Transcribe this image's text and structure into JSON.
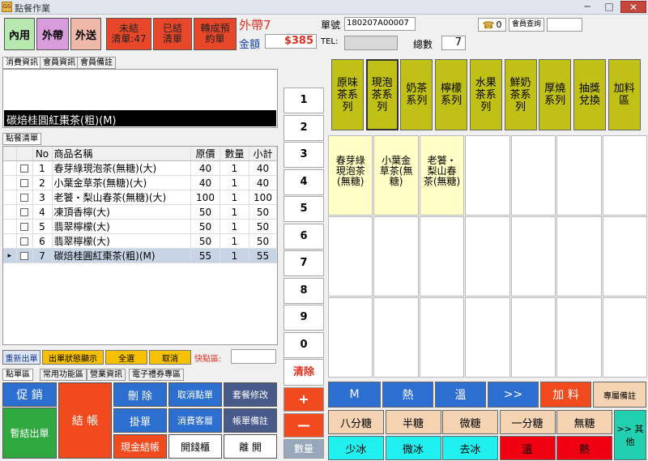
{
  "window": {
    "title": "點餐作業",
    "logo_text": "GS",
    "close_glyph": "✕",
    "minimize_glyph": "─",
    "maximize_glyph": "□"
  },
  "order_type_buttons": [
    {
      "label": "內用",
      "color": "#b7e8b0"
    },
    {
      "label": "外帶",
      "color": "#d99cdc"
    },
    {
      "label": "外送",
      "color": "#f0b8a8"
    }
  ],
  "status_buttons": [
    {
      "line1": "未結",
      "line2": "清單:47"
    },
    {
      "line1": "已結",
      "line2": "清單"
    },
    {
      "line1": "轉成預",
      "line2": "約單"
    }
  ],
  "order_info": {
    "mode_label": "外帶7",
    "amount_label": "金額",
    "amount_value": "$385",
    "order_no_label": "單號",
    "order_no_value": "180207A00007",
    "tel_label": "TEL:",
    "tel_value": "",
    "total_qty_label": "總數",
    "total_qty_value": "7",
    "phone_count": "0",
    "member_query_label": "會員查詢",
    "member_query_value": ""
  },
  "info_tabs": [
    "消費資訊",
    "會員資訊",
    "會員備註"
  ],
  "current_item_display": "碳焙桂圓紅棗茶(粗)(M)",
  "order_list": {
    "tab_label": "點餐清單",
    "columns": [
      "No",
      "商品名稱",
      "原價",
      "數量",
      "小計"
    ],
    "rows": [
      {
        "no": "1",
        "name": "春芽綠現泡茶(無糖)(大)",
        "price": "40",
        "qty": "1",
        "subtotal": "40"
      },
      {
        "no": "2",
        "name": "小葉金草茶(無糖)(大)",
        "price": "40",
        "qty": "1",
        "subtotal": "40"
      },
      {
        "no": "3",
        "name": "老饕・梨山春茶(無糖)(大)",
        "price": "100",
        "qty": "1",
        "subtotal": "100"
      },
      {
        "no": "4",
        "name": "凍頂香檸(大)",
        "price": "50",
        "qty": "1",
        "subtotal": "50"
      },
      {
        "no": "5",
        "name": "翡翠檸檬(大)",
        "price": "50",
        "qty": "1",
        "subtotal": "50"
      },
      {
        "no": "6",
        "name": "翡翠檸檬(大)",
        "price": "50",
        "qty": "1",
        "subtotal": "50"
      },
      {
        "no": "7",
        "name": "碳焙桂圓紅棗茶(粗)(M)",
        "price": "55",
        "qty": "1",
        "subtotal": "55"
      }
    ]
  },
  "list_actions": {
    "reissue": "重新出單",
    "status_show": "出單狀態顯示",
    "select_all": "全選",
    "cancel": "取消",
    "quick_label": "快點區:",
    "quick_value": ""
  },
  "bottom_tabs": [
    "點單區",
    "常用功能區",
    "營業資訊",
    "電子禮券專區"
  ],
  "function_buttons": {
    "promo": "促 銷",
    "temp_out": "暫結出單",
    "checkout": "結 帳",
    "delete": "刪 除",
    "hang": "掛單",
    "cash_checkout": "現金結帳",
    "cancel_item": "取消點單",
    "customer_level": "消費客層",
    "open_drawer": "開錢櫃",
    "package_edit": "套餐修改",
    "bill_note": "帳單備註",
    "leave": "離 開"
  },
  "numpad": {
    "keys": [
      "1",
      "2",
      "3",
      "4",
      "5",
      "6",
      "7",
      "8",
      "9",
      "0"
    ],
    "clear": "清除",
    "plus": "+",
    "minus": "—",
    "qty_label": "數量"
  },
  "categories": [
    "原味茶系列",
    "現泡茶系列",
    "奶茶系列",
    "檸檬系列",
    "水果茶系列",
    "鮮奶茶系列",
    "厚燒系列",
    "抽獎兌換",
    "加料區"
  ],
  "products": [
    "春芽綠現泡茶(無糖)",
    "小葉金草茶(無糖)",
    "老饕・梨山春茶(無糖)"
  ],
  "options": {
    "size_temp": [
      "M",
      "熱",
      "溫",
      ">>"
    ],
    "topping": "加 料",
    "special_note": "專屬備註",
    "sugar": [
      "八分糖",
      "半糖",
      "微糖",
      "一分糖",
      "無糖"
    ],
    "ice": [
      "少冰",
      "微冰",
      "去冰",
      "溫",
      "熱"
    ],
    "other": ">> 其他"
  }
}
